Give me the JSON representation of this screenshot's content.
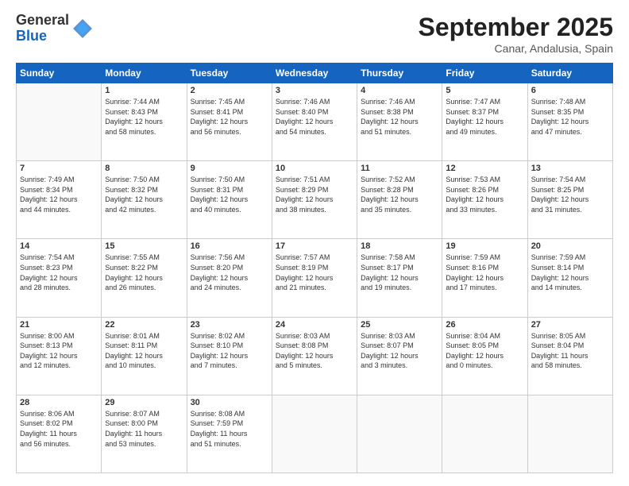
{
  "logo": {
    "general": "General",
    "blue": "Blue"
  },
  "title": "September 2025",
  "subtitle": "Canar, Andalusia, Spain",
  "days_header": [
    "Sunday",
    "Monday",
    "Tuesday",
    "Wednesday",
    "Thursday",
    "Friday",
    "Saturday"
  ],
  "weeks": [
    [
      {
        "day": "",
        "info": ""
      },
      {
        "day": "1",
        "info": "Sunrise: 7:44 AM\nSunset: 8:43 PM\nDaylight: 12 hours\nand 58 minutes."
      },
      {
        "day": "2",
        "info": "Sunrise: 7:45 AM\nSunset: 8:41 PM\nDaylight: 12 hours\nand 56 minutes."
      },
      {
        "day": "3",
        "info": "Sunrise: 7:46 AM\nSunset: 8:40 PM\nDaylight: 12 hours\nand 54 minutes."
      },
      {
        "day": "4",
        "info": "Sunrise: 7:46 AM\nSunset: 8:38 PM\nDaylight: 12 hours\nand 51 minutes."
      },
      {
        "day": "5",
        "info": "Sunrise: 7:47 AM\nSunset: 8:37 PM\nDaylight: 12 hours\nand 49 minutes."
      },
      {
        "day": "6",
        "info": "Sunrise: 7:48 AM\nSunset: 8:35 PM\nDaylight: 12 hours\nand 47 minutes."
      }
    ],
    [
      {
        "day": "7",
        "info": "Sunrise: 7:49 AM\nSunset: 8:34 PM\nDaylight: 12 hours\nand 44 minutes."
      },
      {
        "day": "8",
        "info": "Sunrise: 7:50 AM\nSunset: 8:32 PM\nDaylight: 12 hours\nand 42 minutes."
      },
      {
        "day": "9",
        "info": "Sunrise: 7:50 AM\nSunset: 8:31 PM\nDaylight: 12 hours\nand 40 minutes."
      },
      {
        "day": "10",
        "info": "Sunrise: 7:51 AM\nSunset: 8:29 PM\nDaylight: 12 hours\nand 38 minutes."
      },
      {
        "day": "11",
        "info": "Sunrise: 7:52 AM\nSunset: 8:28 PM\nDaylight: 12 hours\nand 35 minutes."
      },
      {
        "day": "12",
        "info": "Sunrise: 7:53 AM\nSunset: 8:26 PM\nDaylight: 12 hours\nand 33 minutes."
      },
      {
        "day": "13",
        "info": "Sunrise: 7:54 AM\nSunset: 8:25 PM\nDaylight: 12 hours\nand 31 minutes."
      }
    ],
    [
      {
        "day": "14",
        "info": "Sunrise: 7:54 AM\nSunset: 8:23 PM\nDaylight: 12 hours\nand 28 minutes."
      },
      {
        "day": "15",
        "info": "Sunrise: 7:55 AM\nSunset: 8:22 PM\nDaylight: 12 hours\nand 26 minutes."
      },
      {
        "day": "16",
        "info": "Sunrise: 7:56 AM\nSunset: 8:20 PM\nDaylight: 12 hours\nand 24 minutes."
      },
      {
        "day": "17",
        "info": "Sunrise: 7:57 AM\nSunset: 8:19 PM\nDaylight: 12 hours\nand 21 minutes."
      },
      {
        "day": "18",
        "info": "Sunrise: 7:58 AM\nSunset: 8:17 PM\nDaylight: 12 hours\nand 19 minutes."
      },
      {
        "day": "19",
        "info": "Sunrise: 7:59 AM\nSunset: 8:16 PM\nDaylight: 12 hours\nand 17 minutes."
      },
      {
        "day": "20",
        "info": "Sunrise: 7:59 AM\nSunset: 8:14 PM\nDaylight: 12 hours\nand 14 minutes."
      }
    ],
    [
      {
        "day": "21",
        "info": "Sunrise: 8:00 AM\nSunset: 8:13 PM\nDaylight: 12 hours\nand 12 minutes."
      },
      {
        "day": "22",
        "info": "Sunrise: 8:01 AM\nSunset: 8:11 PM\nDaylight: 12 hours\nand 10 minutes."
      },
      {
        "day": "23",
        "info": "Sunrise: 8:02 AM\nSunset: 8:10 PM\nDaylight: 12 hours\nand 7 minutes."
      },
      {
        "day": "24",
        "info": "Sunrise: 8:03 AM\nSunset: 8:08 PM\nDaylight: 12 hours\nand 5 minutes."
      },
      {
        "day": "25",
        "info": "Sunrise: 8:03 AM\nSunset: 8:07 PM\nDaylight: 12 hours\nand 3 minutes."
      },
      {
        "day": "26",
        "info": "Sunrise: 8:04 AM\nSunset: 8:05 PM\nDaylight: 12 hours\nand 0 minutes."
      },
      {
        "day": "27",
        "info": "Sunrise: 8:05 AM\nSunset: 8:04 PM\nDaylight: 11 hours\nand 58 minutes."
      }
    ],
    [
      {
        "day": "28",
        "info": "Sunrise: 8:06 AM\nSunset: 8:02 PM\nDaylight: 11 hours\nand 56 minutes."
      },
      {
        "day": "29",
        "info": "Sunrise: 8:07 AM\nSunset: 8:00 PM\nDaylight: 11 hours\nand 53 minutes."
      },
      {
        "day": "30",
        "info": "Sunrise: 8:08 AM\nSunset: 7:59 PM\nDaylight: 11 hours\nand 51 minutes."
      },
      {
        "day": "",
        "info": ""
      },
      {
        "day": "",
        "info": ""
      },
      {
        "day": "",
        "info": ""
      },
      {
        "day": "",
        "info": ""
      }
    ]
  ]
}
